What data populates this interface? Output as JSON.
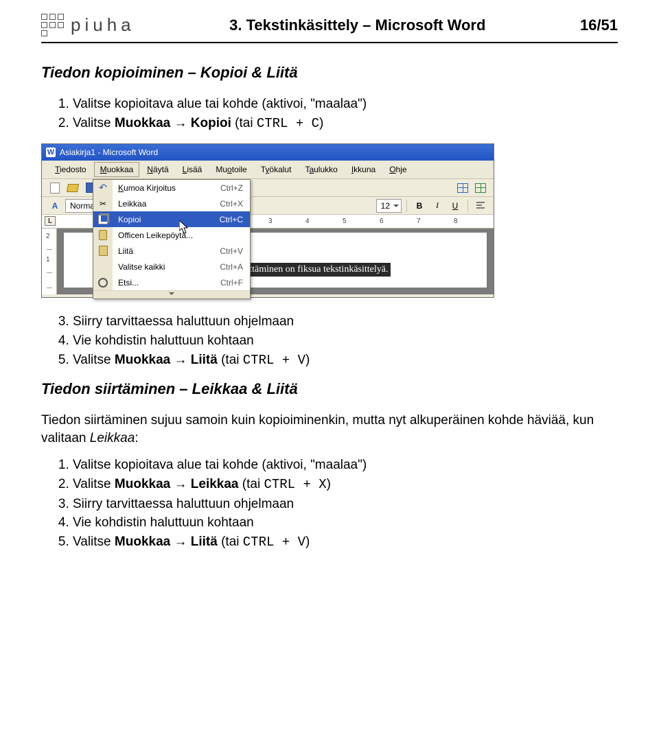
{
  "header": {
    "brand": "piuha",
    "title": "3. Tekstinkäsittely – Microsoft Word",
    "page": "16/51"
  },
  "section1": {
    "title": "Tiedon kopioiminen – Kopioi & Liitä",
    "steps": [
      {
        "t": "Valitse kopioitava alue tai kohde (aktivoi, \"maalaa\")"
      },
      {
        "prefix": "Valitse ",
        "bold": "Muokkaa → Kopioi",
        "suffix_plain": " (tai ",
        "code": "CTRL + C",
        "end": ")"
      }
    ]
  },
  "screenshot": {
    "titlebar": "Asiakirja1 - Microsoft Word",
    "menubar": {
      "items": [
        "Tiedosto",
        "Muokkaa",
        "Näytä",
        "Lisää",
        "Muotoile",
        "Työkalut",
        "Taulukko",
        "Ikkuna",
        "Ohje"
      ],
      "underline": [
        "T",
        "M",
        "N",
        "L",
        "o",
        "y",
        "a",
        "I",
        "O"
      ],
      "open_index": 1
    },
    "dropdown": [
      {
        "icon": "undo",
        "label": "Kumoa Kirjoitus",
        "shortcut": "Ctrl+Z"
      },
      {
        "icon": "cut",
        "label": "Leikkaa",
        "shortcut": "Ctrl+X"
      },
      {
        "icon": "copy",
        "label": "Kopioi",
        "shortcut": "Ctrl+C",
        "hi": true
      },
      {
        "icon": "clip",
        "label": "Officen Leikepöytä...",
        "shortcut": ""
      },
      {
        "icon": "paste",
        "label": "Liitä",
        "shortcut": "Ctrl+V"
      },
      {
        "icon": "",
        "label": "Valitse kaikki",
        "shortcut": "Ctrl+A"
      },
      {
        "icon": "find",
        "label": "Etsi...",
        "shortcut": "Ctrl+F"
      }
    ],
    "toolbar2": {
      "style": "Normal",
      "fontsize": "12"
    },
    "ruler_nums": [
      "3",
      "4",
      "5",
      "6",
      "7",
      "8"
    ],
    "vruler_nums": [
      "2",
      "1"
    ],
    "selected_text": "Tyylien käyttäminen on fiksua tekstinkäsittelyä."
  },
  "afterImage": {
    "steps": [
      {
        "t": "Siirry tarvittaessa haluttuun ohjelmaan"
      },
      {
        "t": "Vie kohdistin haluttuun kohtaan"
      },
      {
        "prefix": "Valitse ",
        "bold": "Muokkaa → Liitä",
        "suffix_plain": " (tai ",
        "code": "CTRL + V",
        "end": ")"
      }
    ],
    "start": 3
  },
  "section2": {
    "title": "Tiedon siirtäminen – Leikkaa & Liitä",
    "intro_a": "Tiedon siirtäminen sujuu samoin kuin kopioiminenkin, mutta nyt alkuperäinen kohde häviää, kun valitaan ",
    "intro_ital": "Leikkaa",
    "intro_b": ":",
    "steps": [
      {
        "t": "Valitse kopioitava alue tai kohde (aktivoi, \"maalaa\")"
      },
      {
        "prefix": "Valitse ",
        "bold": "Muokkaa → Leikkaa",
        "suffix_plain": " (tai ",
        "code": "CTRL + X",
        "end": ")"
      },
      {
        "t": "Siirry tarvittaessa haluttuun ohjelmaan"
      },
      {
        "t": "Vie kohdistin haluttuun kohtaan"
      },
      {
        "prefix": "Valitse ",
        "bold": "Muokkaa → Liitä",
        "suffix_plain": " (tai ",
        "code": "CTRL + V",
        "end": ")"
      }
    ]
  }
}
